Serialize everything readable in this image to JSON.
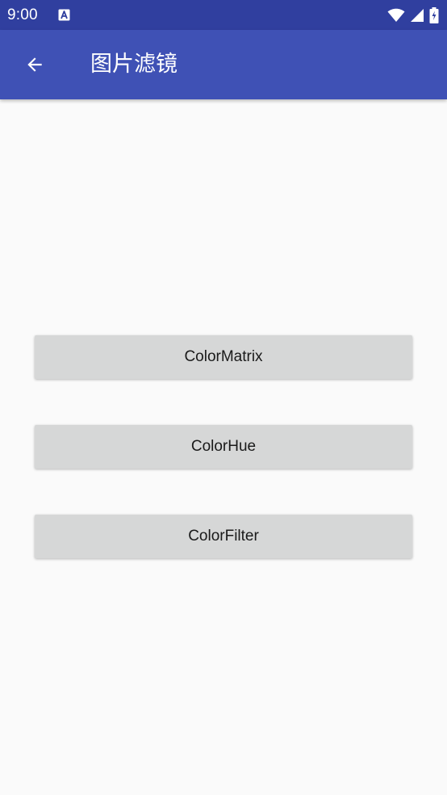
{
  "status_bar": {
    "time": "9:00",
    "background": "#303f9f",
    "icons": [
      "accessibility-notification-icon",
      "wifi-icon",
      "signal-icon",
      "battery-charging-icon"
    ]
  },
  "app_bar": {
    "title": "图片滤镜",
    "background": "#3f51b5",
    "back_icon": "arrow-back-icon"
  },
  "buttons": [
    {
      "label": "ColorMatrix"
    },
    {
      "label": "ColorHue"
    },
    {
      "label": "ColorFilter"
    }
  ],
  "colors": {
    "page_background": "#fafafa",
    "button_background": "#d6d7d7",
    "button_text": "#1a1a1a"
  }
}
